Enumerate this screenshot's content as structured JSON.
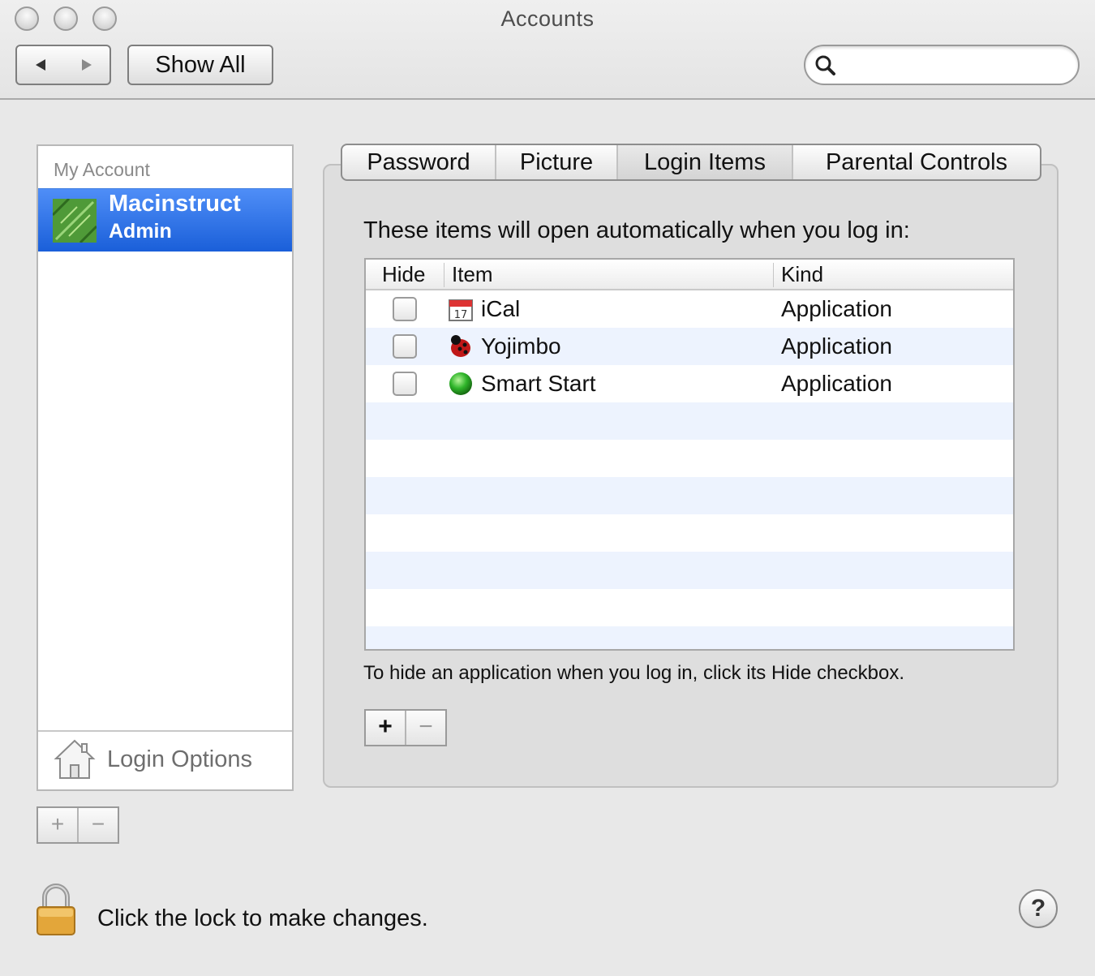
{
  "window": {
    "title": "Accounts"
  },
  "toolbar": {
    "back_icon": "back-arrow-icon",
    "forward_icon": "forward-arrow-icon",
    "show_all_label": "Show All",
    "search": {
      "value": "",
      "placeholder": ""
    }
  },
  "sidebar": {
    "section_header": "My Account",
    "selected_account": {
      "name": "Macinstruct",
      "role": "Admin"
    },
    "login_options_label": "Login Options",
    "add_label": "+",
    "remove_label": "−"
  },
  "tabs": [
    {
      "label": "Password",
      "selected": false
    },
    {
      "label": "Picture",
      "selected": false
    },
    {
      "label": "Login Items",
      "selected": true
    },
    {
      "label": "Parental Controls",
      "selected": false
    }
  ],
  "login_items": {
    "intro": "These items will open automatically when you log in:",
    "columns": {
      "hide": "Hide",
      "item": "Item",
      "kind": "Kind"
    },
    "rows": [
      {
        "hide": false,
        "name": "iCal",
        "kind": "Application",
        "icon": "calendar-icon"
      },
      {
        "hide": false,
        "name": "Yojimbo",
        "kind": "Application",
        "icon": "yojimbo-bug-icon"
      },
      {
        "hide": false,
        "name": "Smart Start",
        "kind": "Application",
        "icon": "green-orb-icon"
      }
    ],
    "hint": "To hide an application when you log in, click its Hide checkbox.",
    "add_label": "+",
    "remove_label": "−"
  },
  "footer": {
    "lock_text": "Click the lock to make changes.",
    "help_label": "?"
  },
  "colors": {
    "selection": "#1a5fd9",
    "row_alt": "#edf3fe",
    "window_bg": "#e8e8e8"
  }
}
